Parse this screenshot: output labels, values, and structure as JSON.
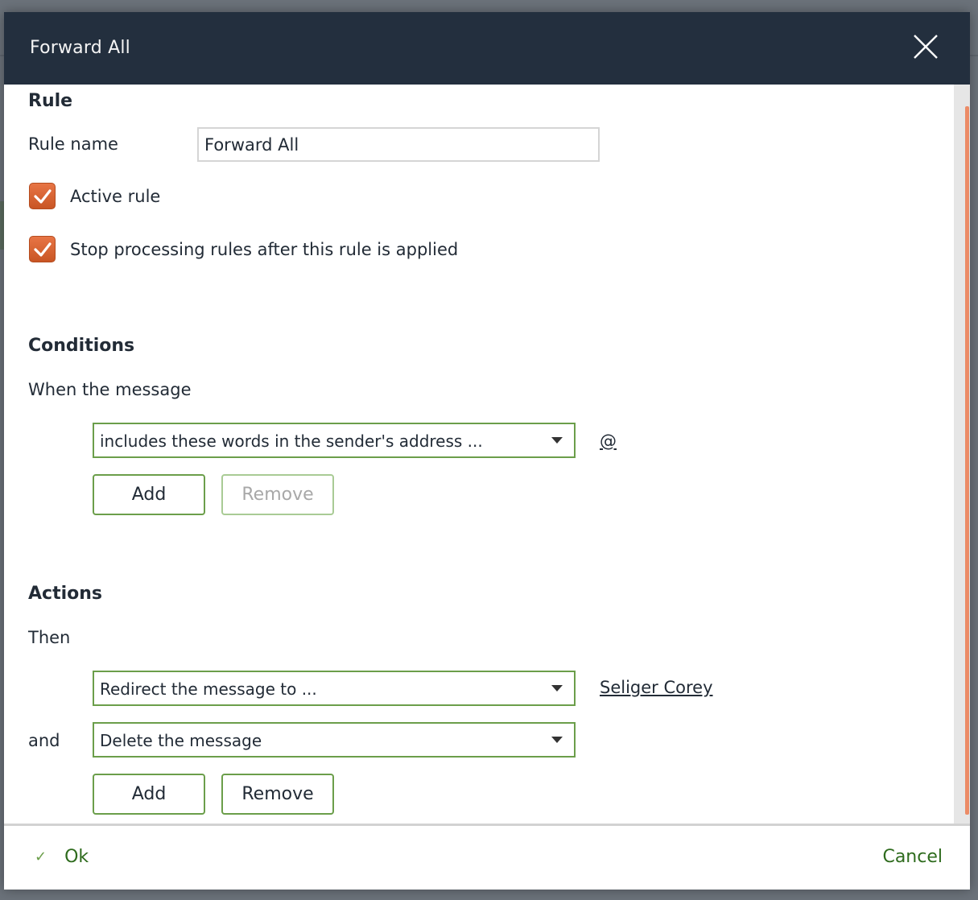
{
  "dialog": {
    "title": "Forward All",
    "close_icon": "close-icon"
  },
  "rule_section": {
    "heading": "Rule",
    "rule_name_label": "Rule name",
    "rule_name_value": "Forward All",
    "active_rule": {
      "label": "Active rule",
      "checked": true
    },
    "stop_processing": {
      "label": "Stop processing rules after this rule is applied",
      "checked": true
    }
  },
  "conditions_section": {
    "heading": "Conditions",
    "intro": "When the message",
    "conditions": [
      {
        "selected": "includes these words in the sender's address ...",
        "value_link": "@"
      }
    ],
    "add_label": "Add",
    "remove_label": "Remove",
    "remove_enabled": false
  },
  "actions_section": {
    "heading": "Actions",
    "intro": "Then",
    "actions": [
      {
        "prefix": "",
        "selected": "Redirect the message to ...",
        "value_link": "Seliger Corey"
      },
      {
        "prefix": "and",
        "selected": "Delete the message",
        "value_link": ""
      }
    ],
    "add_label": "Add",
    "remove_label": "Remove",
    "remove_enabled": true
  },
  "footer": {
    "ok_label": "Ok",
    "ok_icon": "check-icon",
    "cancel_label": "Cancel"
  },
  "colors": {
    "header_bg": "#232f3e",
    "accent_green": "#6b9e4a",
    "checkbox_orange": "#e0652f",
    "scroll_thumb": "#ec8b66",
    "footer_text_green": "#2e6b1d"
  }
}
